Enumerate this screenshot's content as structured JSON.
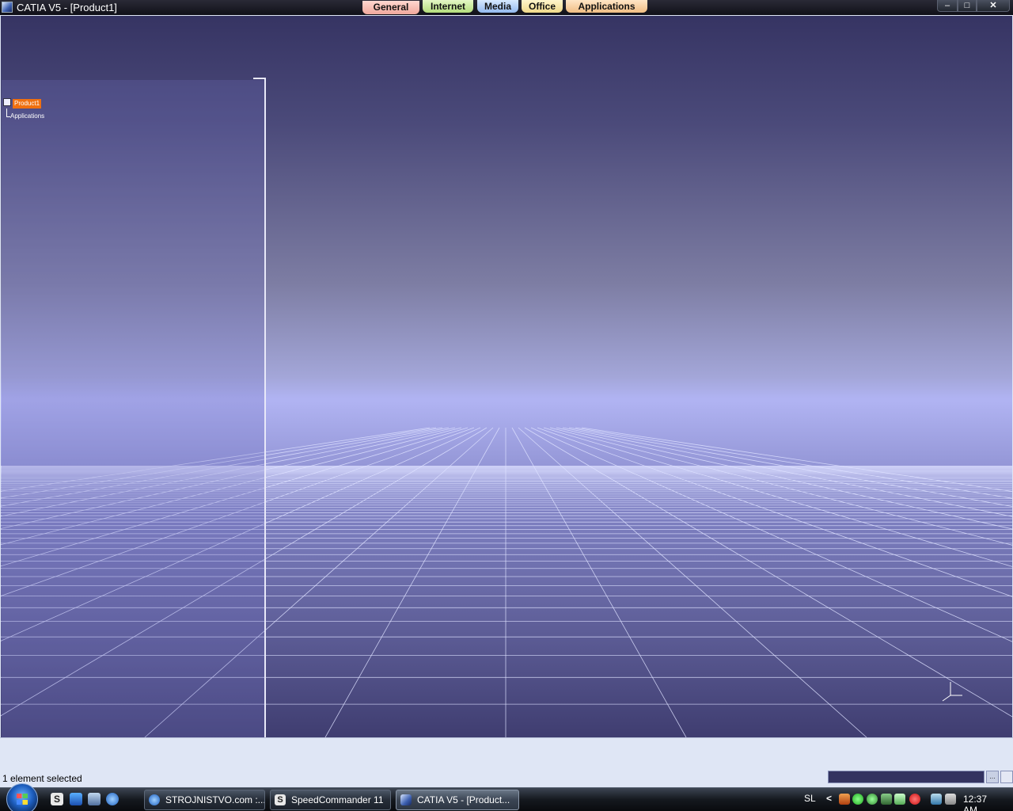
{
  "window": {
    "title": "CATIA V5 - [Product1]",
    "controls": {
      "minimize": "–",
      "restore": "□",
      "close": "✕"
    }
  },
  "ribbon_tabs": [
    {
      "label": "General",
      "color": "#f0a89c"
    },
    {
      "label": "Internet",
      "color": "#b3dd7c"
    },
    {
      "label": "Media",
      "color": "#93b9ef"
    },
    {
      "label": "Office",
      "color": "#f0d98a"
    },
    {
      "label": "Applications",
      "color": "#f0bd84"
    }
  ],
  "tree": {
    "root": "Product1",
    "children": [
      "Applications"
    ],
    "selected_color": "#f07010"
  },
  "status": {
    "message": "1 element selected",
    "command_button": "..."
  },
  "taskbar": {
    "quicklaunch": [
      "speedcommander-icon",
      "desktop-icon",
      "window-switch-icon",
      "internet-explorer-icon"
    ],
    "ql_s_glyph": "S",
    "tasks": [
      {
        "label": "STROJNISTVO.com :...",
        "icon": "internet-explorer-icon"
      },
      {
        "label": "SpeedCommander 11",
        "icon": "speedcommander-icon",
        "glyph": "S"
      },
      {
        "label": "CATIA V5 - [Product...",
        "icon": "catia-icon"
      }
    ],
    "tray": {
      "language": "SL",
      "chevron": "<",
      "clock": "12:37 AM"
    }
  },
  "colors": {
    "viewport_top": "#363463",
    "viewport_horizon": "#b0b3f2",
    "viewport_bottom": "#3f3d70",
    "grid_line": "#dde0ff"
  }
}
